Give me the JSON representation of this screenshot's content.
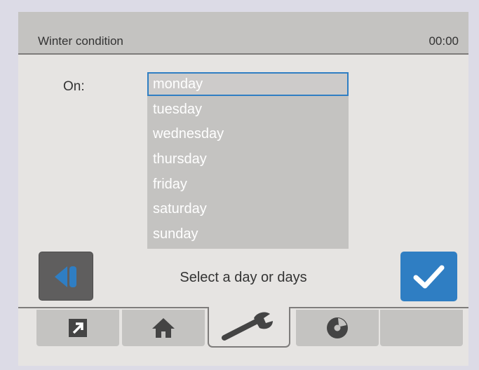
{
  "header": {
    "title": "Winter condition",
    "time": "00:00"
  },
  "form": {
    "on_label": "On:",
    "days": [
      "monday",
      "tuesday",
      "wednesday",
      "thursday",
      "friday",
      "saturday",
      "sunday"
    ],
    "selected": "monday"
  },
  "footer": {
    "hint": "Select a day or days"
  },
  "nav": {
    "tabs": [
      {
        "icon": "arrow-up-right-icon"
      },
      {
        "icon": "home-icon"
      },
      {
        "icon": "wrench-icon",
        "active": true
      },
      {
        "icon": "disc-icon"
      },
      {
        "icon": ""
      }
    ]
  },
  "colors": {
    "accent": "#2f7ec3",
    "dark_button": "#5f5e5e",
    "panel": "#c4c3c1",
    "background": "#e6e4e2"
  }
}
